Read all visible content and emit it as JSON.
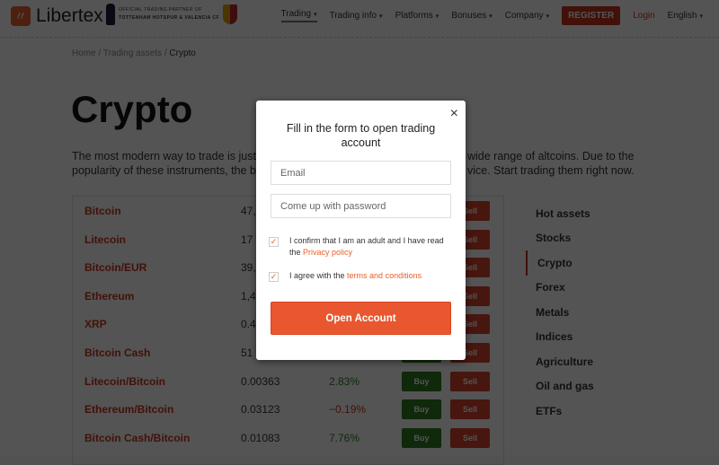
{
  "header": {
    "logo": "Libertex",
    "partner": [
      "OFFICIAL TRADING PARTNER OF",
      "TOTTENHAM HOTSPUR & VALENCIA CF"
    ],
    "nav": [
      "Trading",
      "Trading info",
      "Platforms",
      "Bonuses",
      "Company"
    ],
    "register": "REGISTER",
    "login": "Login",
    "language": "English"
  },
  "breadcrumb": [
    "Home",
    "Trading assets",
    "Crypto"
  ],
  "title": "Crypto",
  "intro": {
    "l1a": "The most modern way to trade is just c",
    "l1b": "wide range of altcoins. Due to the",
    "l2a": "popularity of these instruments, the br",
    "l2b": "vice. Start trading them right now."
  },
  "table": {
    "buy": "Buy",
    "sell": "Sell",
    "rows": [
      {
        "name": "Bitcoin",
        "price": "47,",
        "change": ""
      },
      {
        "name": "Litecoin",
        "price": "17",
        "change": ""
      },
      {
        "name": "Bitcoin/EUR",
        "price": "39,",
        "change": ""
      },
      {
        "name": "Ethereum",
        "price": "1,4",
        "change": ""
      },
      {
        "name": "XRP",
        "price": "0.4",
        "change": ""
      },
      {
        "name": "Bitcoin Cash",
        "price": "51",
        "change": ""
      },
      {
        "name": "Litecoin/Bitcoin",
        "price": "0.00363",
        "change": "2.83%"
      },
      {
        "name": "Ethereum/Bitcoin",
        "price": "0.03123",
        "change": "−0.19%"
      },
      {
        "name": "Bitcoin Cash/Bitcoin",
        "price": "0.01083",
        "change": "7.76%"
      }
    ]
  },
  "sidebar": [
    "Hot assets",
    "Stocks",
    "Crypto",
    "Forex",
    "Metals",
    "Indices",
    "Agriculture",
    "Oil and gas",
    "ETFs"
  ],
  "modal": {
    "title": "Fill in the form to open trading account",
    "email_placeholder": "Email",
    "password_placeholder": "Come up with password",
    "confirm_text": "I confirm that I am an adult and I have read the ",
    "privacy_link": "Privacy policy",
    "agree_text": "I agree with the ",
    "terms_link": "terms and conditions",
    "submit": "Open Account",
    "close": "×",
    "check": "✓"
  },
  "colors": {
    "accent": "#e8572f",
    "buy": "#2e7d1e",
    "sell": "#d8432a",
    "positive": "#2e7d1e",
    "negative": "#c9351f"
  }
}
